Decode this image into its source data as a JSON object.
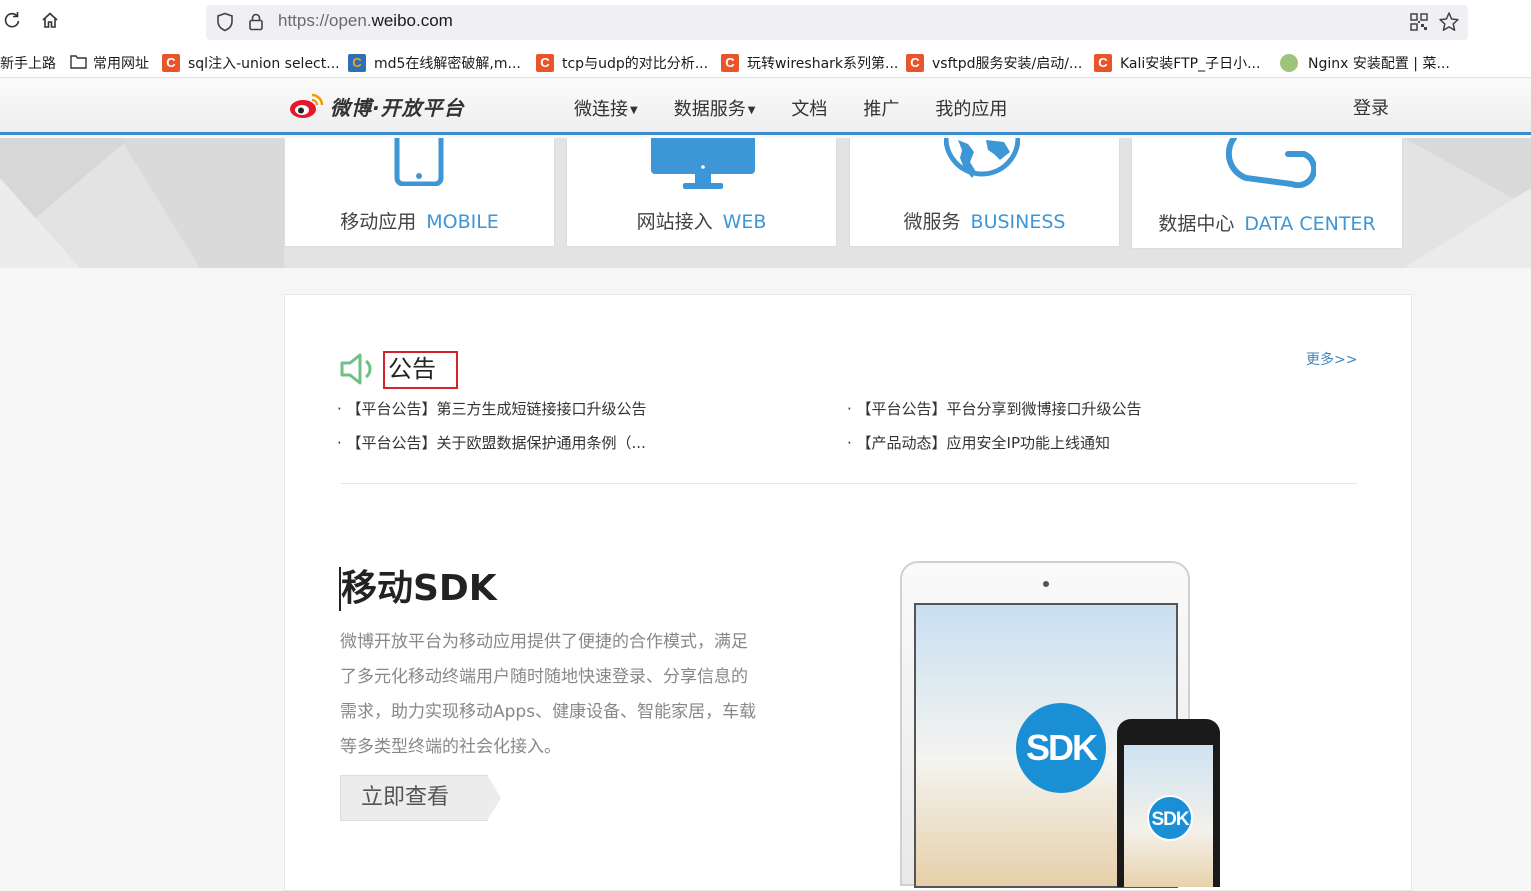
{
  "browser": {
    "url_prefix": "https://open.",
    "url_domain": "weibo.com"
  },
  "bookmarks": [
    {
      "label": "新手上路",
      "icon": "none"
    },
    {
      "label": "常用网址",
      "icon": "folder-icon"
    },
    {
      "label": "sql注入-union select...",
      "icon": "csdn-icon"
    },
    {
      "label": "md5在线解密破解,m...",
      "icon": "cmd5-icon"
    },
    {
      "label": "tcp与udp的对比分析...",
      "icon": "csdn-icon"
    },
    {
      "label": "玩转wireshark系列第...",
      "icon": "csdn-icon"
    },
    {
      "label": "vsftpd服务安装/启动/...",
      "icon": "csdn-icon"
    },
    {
      "label": "Kali安装FTP_子日小...",
      "icon": "csdn-icon"
    },
    {
      "label": "Nginx 安装配置 | 菜...",
      "icon": "runoob-icon"
    }
  ],
  "header": {
    "logo_text": "微博·开放平台",
    "nav": [
      {
        "label": "微连接",
        "dropdown": true
      },
      {
        "label": "数据服务",
        "dropdown": true
      },
      {
        "label": "文档",
        "dropdown": false
      },
      {
        "label": "推广",
        "dropdown": false
      },
      {
        "label": "我的应用",
        "dropdown": false
      }
    ],
    "login": "登录"
  },
  "cards": [
    {
      "zh": "移动应用",
      "en": "MOBILE",
      "icon": "mobile-icon"
    },
    {
      "zh": "网站接入",
      "en": "WEB",
      "icon": "monitor-icon"
    },
    {
      "zh": "微服务",
      "en": "BUSINESS",
      "icon": "globe-icon"
    },
    {
      "zh": "数据中心",
      "en": "DATA CENTER",
      "icon": "cloud-icon"
    }
  ],
  "notice": {
    "title": "公告",
    "more": "更多>>",
    "items": [
      "· 【平台公告】第三方生成短链接接口升级公告",
      "· 【平台公告】平台分享到微博接口升级公告",
      "· 【平台公告】关于欧盟数据保护通用条例（...",
      "· 【产品动态】应用安全IP功能上线通知"
    ]
  },
  "sdk": {
    "title": "移动SDK",
    "desc": "微博开放平台为移动应用提供了便捷的合作模式，满足了多元化移动终端用户随时随地快速登录、分享信息的需求，助力实现移动Apps、健康设备、智能家居，车载等多类型终端的社会化接入。",
    "button": "立即查看",
    "badge": "SDK"
  },
  "colors": {
    "accent_blue": "#3a8ccd",
    "card_en": "#3d96d6",
    "highlight_red": "#d4232b"
  }
}
